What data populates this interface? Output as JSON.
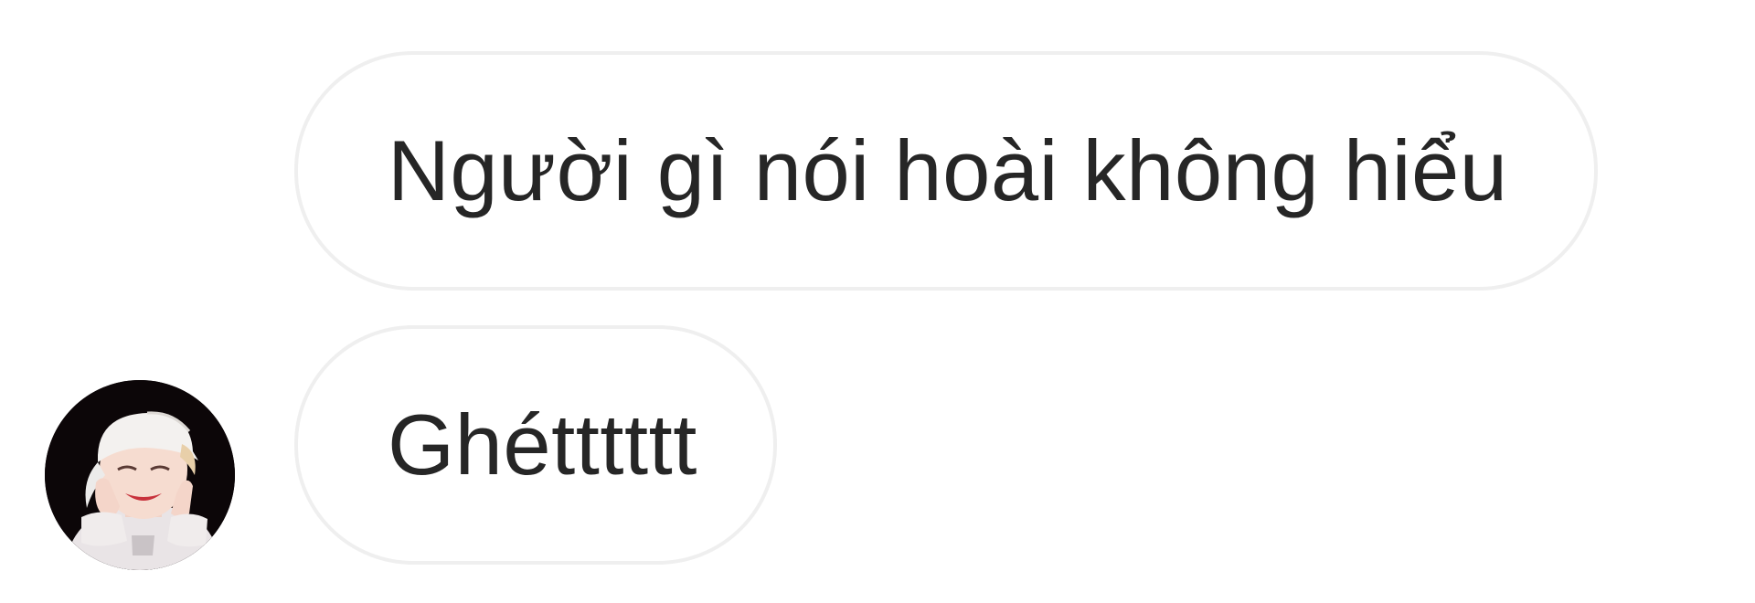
{
  "conversation": {
    "messages": [
      {
        "text": "Người gì nói hoài không hiểu"
      },
      {
        "text": "Ghétttttt"
      }
    ],
    "avatar": {
      "icon": "user-avatar-photo"
    }
  },
  "colors": {
    "bubble_border": "#efefef",
    "text": "#262626",
    "background": "#ffffff"
  }
}
